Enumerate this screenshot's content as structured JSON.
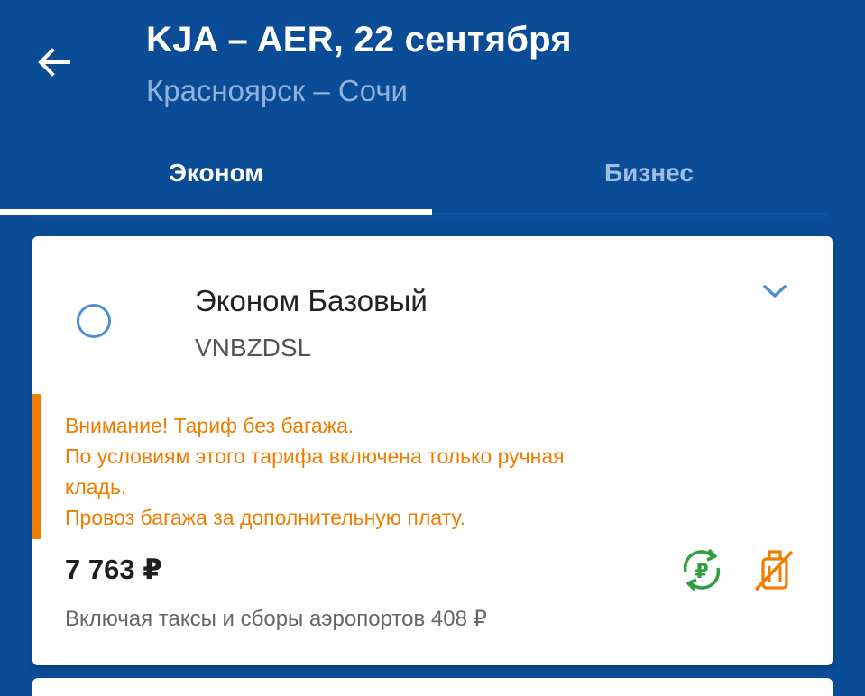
{
  "header": {
    "title": "KJA – AER, 22 сентября",
    "subtitle": "Красноярск – Сочи",
    "back_icon": "arrow-left-icon"
  },
  "tabs": [
    {
      "label": "Эконом",
      "active": true
    },
    {
      "label": "Бизнес",
      "active": false
    }
  ],
  "tariff": {
    "name": "Эконом Базовый",
    "code": "VNBZDSL",
    "selected": false,
    "warning": {
      "lines": [
        "Внимание! Тариф без багажа.",
        "По условиям этого тарифа включена только ручная",
        "кладь.",
        "Провоз багажа за дополнительную плату."
      ]
    },
    "price": "7 763 ₽",
    "taxes_note": "Включая таксы и сборы аэропортов 408 ₽",
    "icons": [
      "refund-ruble-icon",
      "no-baggage-icon",
      "chevron-down-icon"
    ]
  },
  "colors": {
    "header_bg": "#0a4c95",
    "accent_blue": "#4f8ed6",
    "warning_orange": "#ef7d00",
    "refund_green": "#2e9e3e"
  }
}
